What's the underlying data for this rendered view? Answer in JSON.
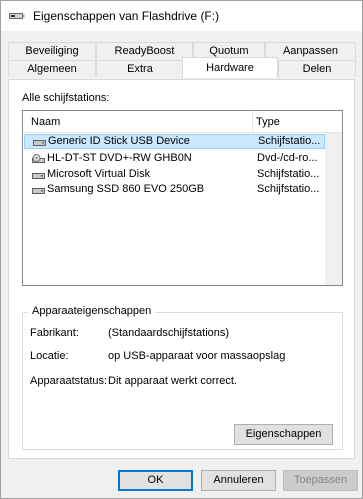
{
  "window": {
    "title": "Eigenschappen van Flashdrive (F:)",
    "title_icon": "usb-drive-icon"
  },
  "tabs_row1": [
    {
      "label": "Beveiliging"
    },
    {
      "label": "ReadyBoost"
    },
    {
      "label": "Quotum"
    },
    {
      "label": "Aanpassen"
    }
  ],
  "tabs_row2": [
    {
      "label": "Algemeen"
    },
    {
      "label": "Extra"
    },
    {
      "label": "Hardware",
      "active": true
    },
    {
      "label": "Delen"
    }
  ],
  "hardware": {
    "list_label": "Alle schijfstations:",
    "columns": {
      "name": "Naam",
      "type": "Type"
    },
    "devices": [
      {
        "name": "Generic ID Stick USB Device",
        "type": "Schijfstatio...",
        "icon": "drive-icon",
        "selected": true
      },
      {
        "name": "HL-DT-ST DVD+-RW GHB0N",
        "type": "Dvd-/cd-ro...",
        "icon": "dvd-drive-icon"
      },
      {
        "name": "Microsoft Virtual Disk",
        "type": "Schijfstatio...",
        "icon": "drive-icon"
      },
      {
        "name": "Samsung SSD 860 EVO 250GB",
        "type": "Schijfstatio...",
        "icon": "drive-icon"
      }
    ],
    "properties": {
      "group_title": "Apparaateigenschappen",
      "manufacturer_label": "Fabrikant:",
      "manufacturer_value": "(Standaardschijfstations)",
      "location_label": "Locatie:",
      "location_value": "op USB-apparaat voor massaopslag",
      "status_label": "Apparaatstatus:",
      "status_value": "Dit apparaat werkt correct.",
      "properties_button": "Eigenschappen"
    }
  },
  "footer": {
    "ok": "OK",
    "cancel": "Annuleren",
    "apply": "Toepassen"
  },
  "colors": {
    "selection_bg": "#cce8ff",
    "selection_border": "#99d1ff",
    "default_button_border": "#0078d7"
  }
}
